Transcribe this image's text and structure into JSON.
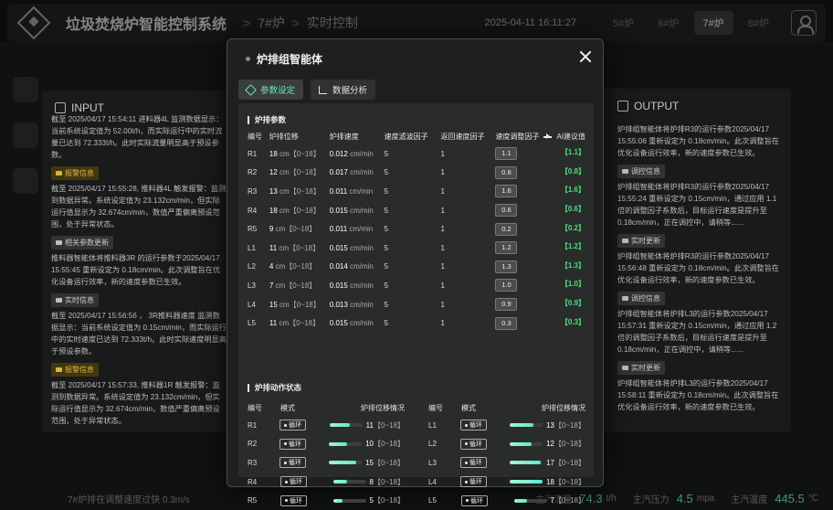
{
  "app": {
    "title": "垃圾焚烧炉智能控制系统",
    "breadcrumb": [
      "7#炉",
      "实时控制"
    ],
    "datetime": "2025-04-11 16:11:27"
  },
  "furnaces": [
    {
      "label": "5#炉",
      "active": false
    },
    {
      "label": "6#炉",
      "active": false
    },
    {
      "label": "7#炉",
      "active": true
    },
    {
      "label": "8#炉",
      "active": false
    }
  ],
  "input_panel": {
    "title": "INPUT",
    "entries": [
      {
        "type": "text",
        "text": "截至 2025/04/17 15:54:11 进料器4L 监测数据显示：当前系统设定值为 52.00t/h，而实际运行中的实时流量已达到 72.333t/h。此时实际流量明显高于预设参数。"
      },
      {
        "type": "badge",
        "level": "warn",
        "text": "报警信息"
      },
      {
        "type": "text",
        "text": "截至 2025/04/17 15:55:28, 推料器4L 触发报警：监测到数据异常。系统设定值为 23.132cm/min，但实际运行值显示为 32.674cm/min，数值严重偏离预设范围，处于异常状态。"
      },
      {
        "type": "badge",
        "level": "gray",
        "text": "相关参数更新"
      },
      {
        "type": "text",
        "text": "推料器智能体将推料器3R 的运行参数于2025/04/17 15:55:45 重新设定为 0.18cm/min。此次调整旨在优化设备运行效率，新的速度参数已生效。"
      },
      {
        "type": "badge",
        "level": "gray",
        "text": "实时信息"
      },
      {
        "type": "text",
        "text": "截至 2025/04/17 15:56:56 ， 3R推料器速度 监测数据显示：当前系统设定值为 0.15cm/min，而实际运行中的实时速度已达到 72.333t/h。此时实际速度明显高于预设参数。"
      },
      {
        "type": "badge",
        "level": "warn",
        "text": "报警信息"
      },
      {
        "type": "text",
        "text": "截至 2025/04/17 15:57:33, 推料器1R 触发报警：监测到数据异常。系统设定值为 23.132cm/min，但实际运行值显示为 32.674cm/min，数值严重偏离预设范围，处于异常状态。"
      }
    ]
  },
  "output_panel": {
    "title": "OUTPUT",
    "entries": [
      {
        "type": "text",
        "text": "炉排组智能体将炉排R3的运行参数2025/04/17 15:55:06 重新设定为 0.18cm/min。此次调整旨在优化设备运行效率，新的速度参数已生效。"
      },
      {
        "type": "badge",
        "text": "调控信息"
      },
      {
        "type": "text",
        "text": "炉排组智能体将炉排R3的运行参数2025/04/17 15:55:24 重新设定为 0.15cm/min，通过应用 1.1 倍的调整因子系数后，目标运行速度是提升至 0.18cm/min，正在调控中，请稍等......"
      },
      {
        "type": "badge",
        "text": "实时更新"
      },
      {
        "type": "text",
        "text": "炉排组智能体将炉排R3的运行参数2025/04/17 15:56:48 重新设定为 0.18cm/min。此次调整旨在优化设备运行效率，新的速度参数已生效。"
      },
      {
        "type": "badge",
        "text": "调控信息"
      },
      {
        "type": "text",
        "text": "炉排组智能体将炉排L3的运行参数2025/04/17 15:57:31 重新设定为 0.15cm/min，通过应用 1.2 倍的调整因子系数后，目标运行速度是提升至 0.18cm/min，正在调控中，请稍等......"
      },
      {
        "type": "badge",
        "text": "实时更新"
      },
      {
        "type": "text",
        "text": "炉排组智能体将炉排L3的运行参数2025/04/17 15:58:11 重新设定为 0.18cm/min。此次调整旨在优化设备运行效率，新的速度参数已生效。"
      }
    ]
  },
  "bottombar": {
    "alert": "7#炉排在调整速度过快 0.3m/s",
    "steam_flow_label": "主汽流量",
    "steam_flow": "74.3",
    "steam_flow_unit": "t/h",
    "steam_pressure_label": "主汽压力",
    "steam_pressure": "4.5",
    "steam_pressure_unit": "mpa",
    "steam_temp_label": "主汽温度",
    "steam_temp": "445.5",
    "steam_temp_unit": "℃"
  },
  "modal": {
    "title": "炉排组智能体",
    "tabs": [
      {
        "label": "参数设定",
        "icon": "settings-icon",
        "active": true
      },
      {
        "label": "数据分析",
        "icon": "chart-icon",
        "active": false
      }
    ],
    "params_section": "炉排参数",
    "params_headers": {
      "id": "编号",
      "pos": "炉排位移",
      "speed": "炉排速度",
      "filter": "速度滤波因子",
      "return": "返回速度因子",
      "adj": "速度调整因子",
      "ai": "AI建议值"
    },
    "params": [
      {
        "id": "R1",
        "pos": "18",
        "pos_unit": "cm【0~18】",
        "speed": "0.012",
        "speed_unit": "cm/min",
        "filter": "5",
        "return": "1",
        "adj": "1.1",
        "ai": "【1.1】"
      },
      {
        "id": "R2",
        "pos": "12",
        "pos_unit": "cm【0~18】",
        "speed": "0.017",
        "speed_unit": "cm/min",
        "filter": "5",
        "return": "1",
        "adj": "0.8",
        "ai": "【0.8】"
      },
      {
        "id": "R3",
        "pos": "13",
        "pos_unit": "cm【0~18】",
        "speed": "0.011",
        "speed_unit": "cm/min",
        "filter": "5",
        "return": "1",
        "adj": "1.6",
        "ai": "【1.6】"
      },
      {
        "id": "R4",
        "pos": "18",
        "pos_unit": "cm【0~18】",
        "speed": "0.015",
        "speed_unit": "cm/min",
        "filter": "5",
        "return": "1",
        "adj": "0.6",
        "ai": "【0.6】"
      },
      {
        "id": "R5",
        "pos": "9",
        "pos_unit": "cm【0~18】",
        "speed": "0.011",
        "speed_unit": "cm/min",
        "filter": "5",
        "return": "1",
        "adj": "0.2",
        "ai": "【0.2】"
      },
      {
        "id": "L1",
        "pos": "11",
        "pos_unit": "cm【0~18】",
        "speed": "0.015",
        "speed_unit": "cm/min",
        "filter": "5",
        "return": "1",
        "adj": "1.2",
        "ai": "【1.2】"
      },
      {
        "id": "L2",
        "pos": "4",
        "pos_unit": "cm【0~18】",
        "speed": "0.014",
        "speed_unit": "cm/min",
        "filter": "5",
        "return": "1",
        "adj": "1.3",
        "ai": "【1.3】"
      },
      {
        "id": "L3",
        "pos": "7",
        "pos_unit": "cm【0~18】",
        "speed": "0.015",
        "speed_unit": "cm/min",
        "filter": "5",
        "return": "1",
        "adj": "1.0",
        "ai": "【1.0】"
      },
      {
        "id": "L4",
        "pos": "15",
        "pos_unit": "cm【0~18】",
        "speed": "0.013",
        "speed_unit": "cm/min",
        "filter": "5",
        "return": "1",
        "adj": "0.9",
        "ai": "【0.9】"
      },
      {
        "id": "L5",
        "pos": "11",
        "pos_unit": "cm【0~18】",
        "speed": "0.015",
        "speed_unit": "cm/min",
        "filter": "5",
        "return": "1",
        "adj": "0.3",
        "ai": "【0.3】"
      }
    ],
    "status_section": "炉排动作状态",
    "status_headers": {
      "id": "编号",
      "mode": "模式",
      "pos": "炉排位移情况"
    },
    "status_left": [
      {
        "id": "R1",
        "mode": "循环",
        "pos": "11",
        "range": "【0~18】",
        "level": 0.61
      },
      {
        "id": "R2",
        "mode": "循环",
        "pos": "10",
        "range": "【0~18】",
        "level": 0.56
      },
      {
        "id": "R3",
        "mode": "循环",
        "pos": "15",
        "range": "【0~18】",
        "level": 0.83
      },
      {
        "id": "R4",
        "mode": "循环",
        "pos": "8",
        "range": "【0~18】",
        "level": 0.44
      },
      {
        "id": "R5",
        "mode": "循环",
        "pos": "5",
        "range": "【0~18】",
        "level": 0.28
      }
    ],
    "status_right": [
      {
        "id": "L1",
        "mode": "循环",
        "pos": "13",
        "range": "【0~18】",
        "level": 0.72
      },
      {
        "id": "L2",
        "mode": "循环",
        "pos": "12",
        "range": "【0~18】",
        "level": 0.67
      },
      {
        "id": "L3",
        "mode": "循环",
        "pos": "17",
        "range": "【0~18】",
        "level": 0.94
      },
      {
        "id": "L4",
        "mode": "循环",
        "pos": "18",
        "range": "【0~18】",
        "level": 1.0
      },
      {
        "id": "L5",
        "mode": "循环",
        "pos": "7",
        "range": "【0~18】",
        "level": 0.39
      }
    ]
  }
}
